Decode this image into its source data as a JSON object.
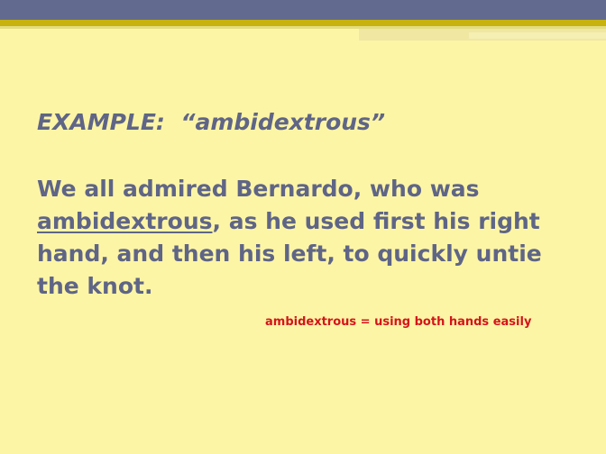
{
  "slide": {
    "heading_label": "EXAMPLE:",
    "heading_word": "“ambidextrous”",
    "sentence_before": "We all admired Bernardo, who was ",
    "sentence_key_word": "ambidextrous",
    "sentence_after": ",  as he used first his right hand, and then his left, to quickly untie the knot.",
    "definition": "ambidextrous = using both hands easily"
  },
  "colors": {
    "background": "#fdf5a6",
    "top_band": "#636a8f",
    "gold_rule": "#c7b20f",
    "body_text": "#5f6586",
    "definition_text": "#d4141a"
  }
}
